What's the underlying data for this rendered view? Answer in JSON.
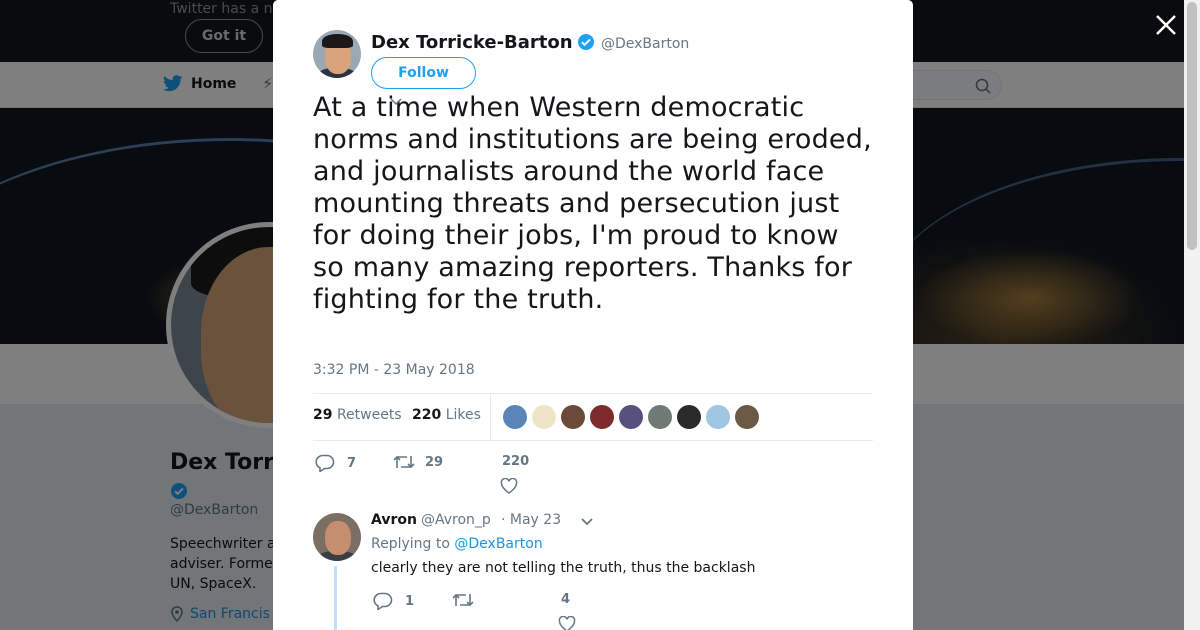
{
  "background": {
    "notice_text": "Twitter has a n",
    "got_it_label": "Got it",
    "nav_home_label": "Home",
    "profile": {
      "name": "Dex Torr",
      "handle": "@DexBarton",
      "bio_lines": [
        "Speechwriter a",
        "adviser. Forme",
        "UN, SpaceX."
      ],
      "location": "San Francis"
    }
  },
  "tweet": {
    "author_name": "Dex Torricke-Barton",
    "author_handle": "@DexBarton",
    "follow_label": "Follow",
    "text": "At a time when Western democratic norms and institutions are being eroded, and journalists around the world face mounting threats and persecution just for doing their jobs, I'm proud to know so many amazing reporters. Thanks for fighting for the truth.",
    "timestamp": "3:32 PM - 23 May 2018",
    "retweets_count": "29",
    "retweets_label": "Retweets",
    "likes_count": "220",
    "likes_label": "Likes",
    "liker_colors": [
      "#5b84b8",
      "#efe6c8",
      "#6b4a3a",
      "#7c2c2c",
      "#58507c",
      "#6f7a72",
      "#2a2a2a",
      "#9fc7e3",
      "#6b5a44"
    ],
    "actions": {
      "reply_count": "7",
      "retweet_count": "29",
      "like_count": "220"
    }
  },
  "reply": {
    "name": "Avron",
    "handle": "@Avron_p",
    "date": "· May 23",
    "replying_prefix": "Replying to",
    "replying_to": "@DexBarton",
    "text": "clearly they are not telling the truth, thus the backlash",
    "reply_count": "1",
    "retweet_count": "",
    "like_count": "4"
  },
  "colors": {
    "accent": "#1da1f2",
    "verified": "#1da1f2",
    "like_heart": "#657786"
  }
}
